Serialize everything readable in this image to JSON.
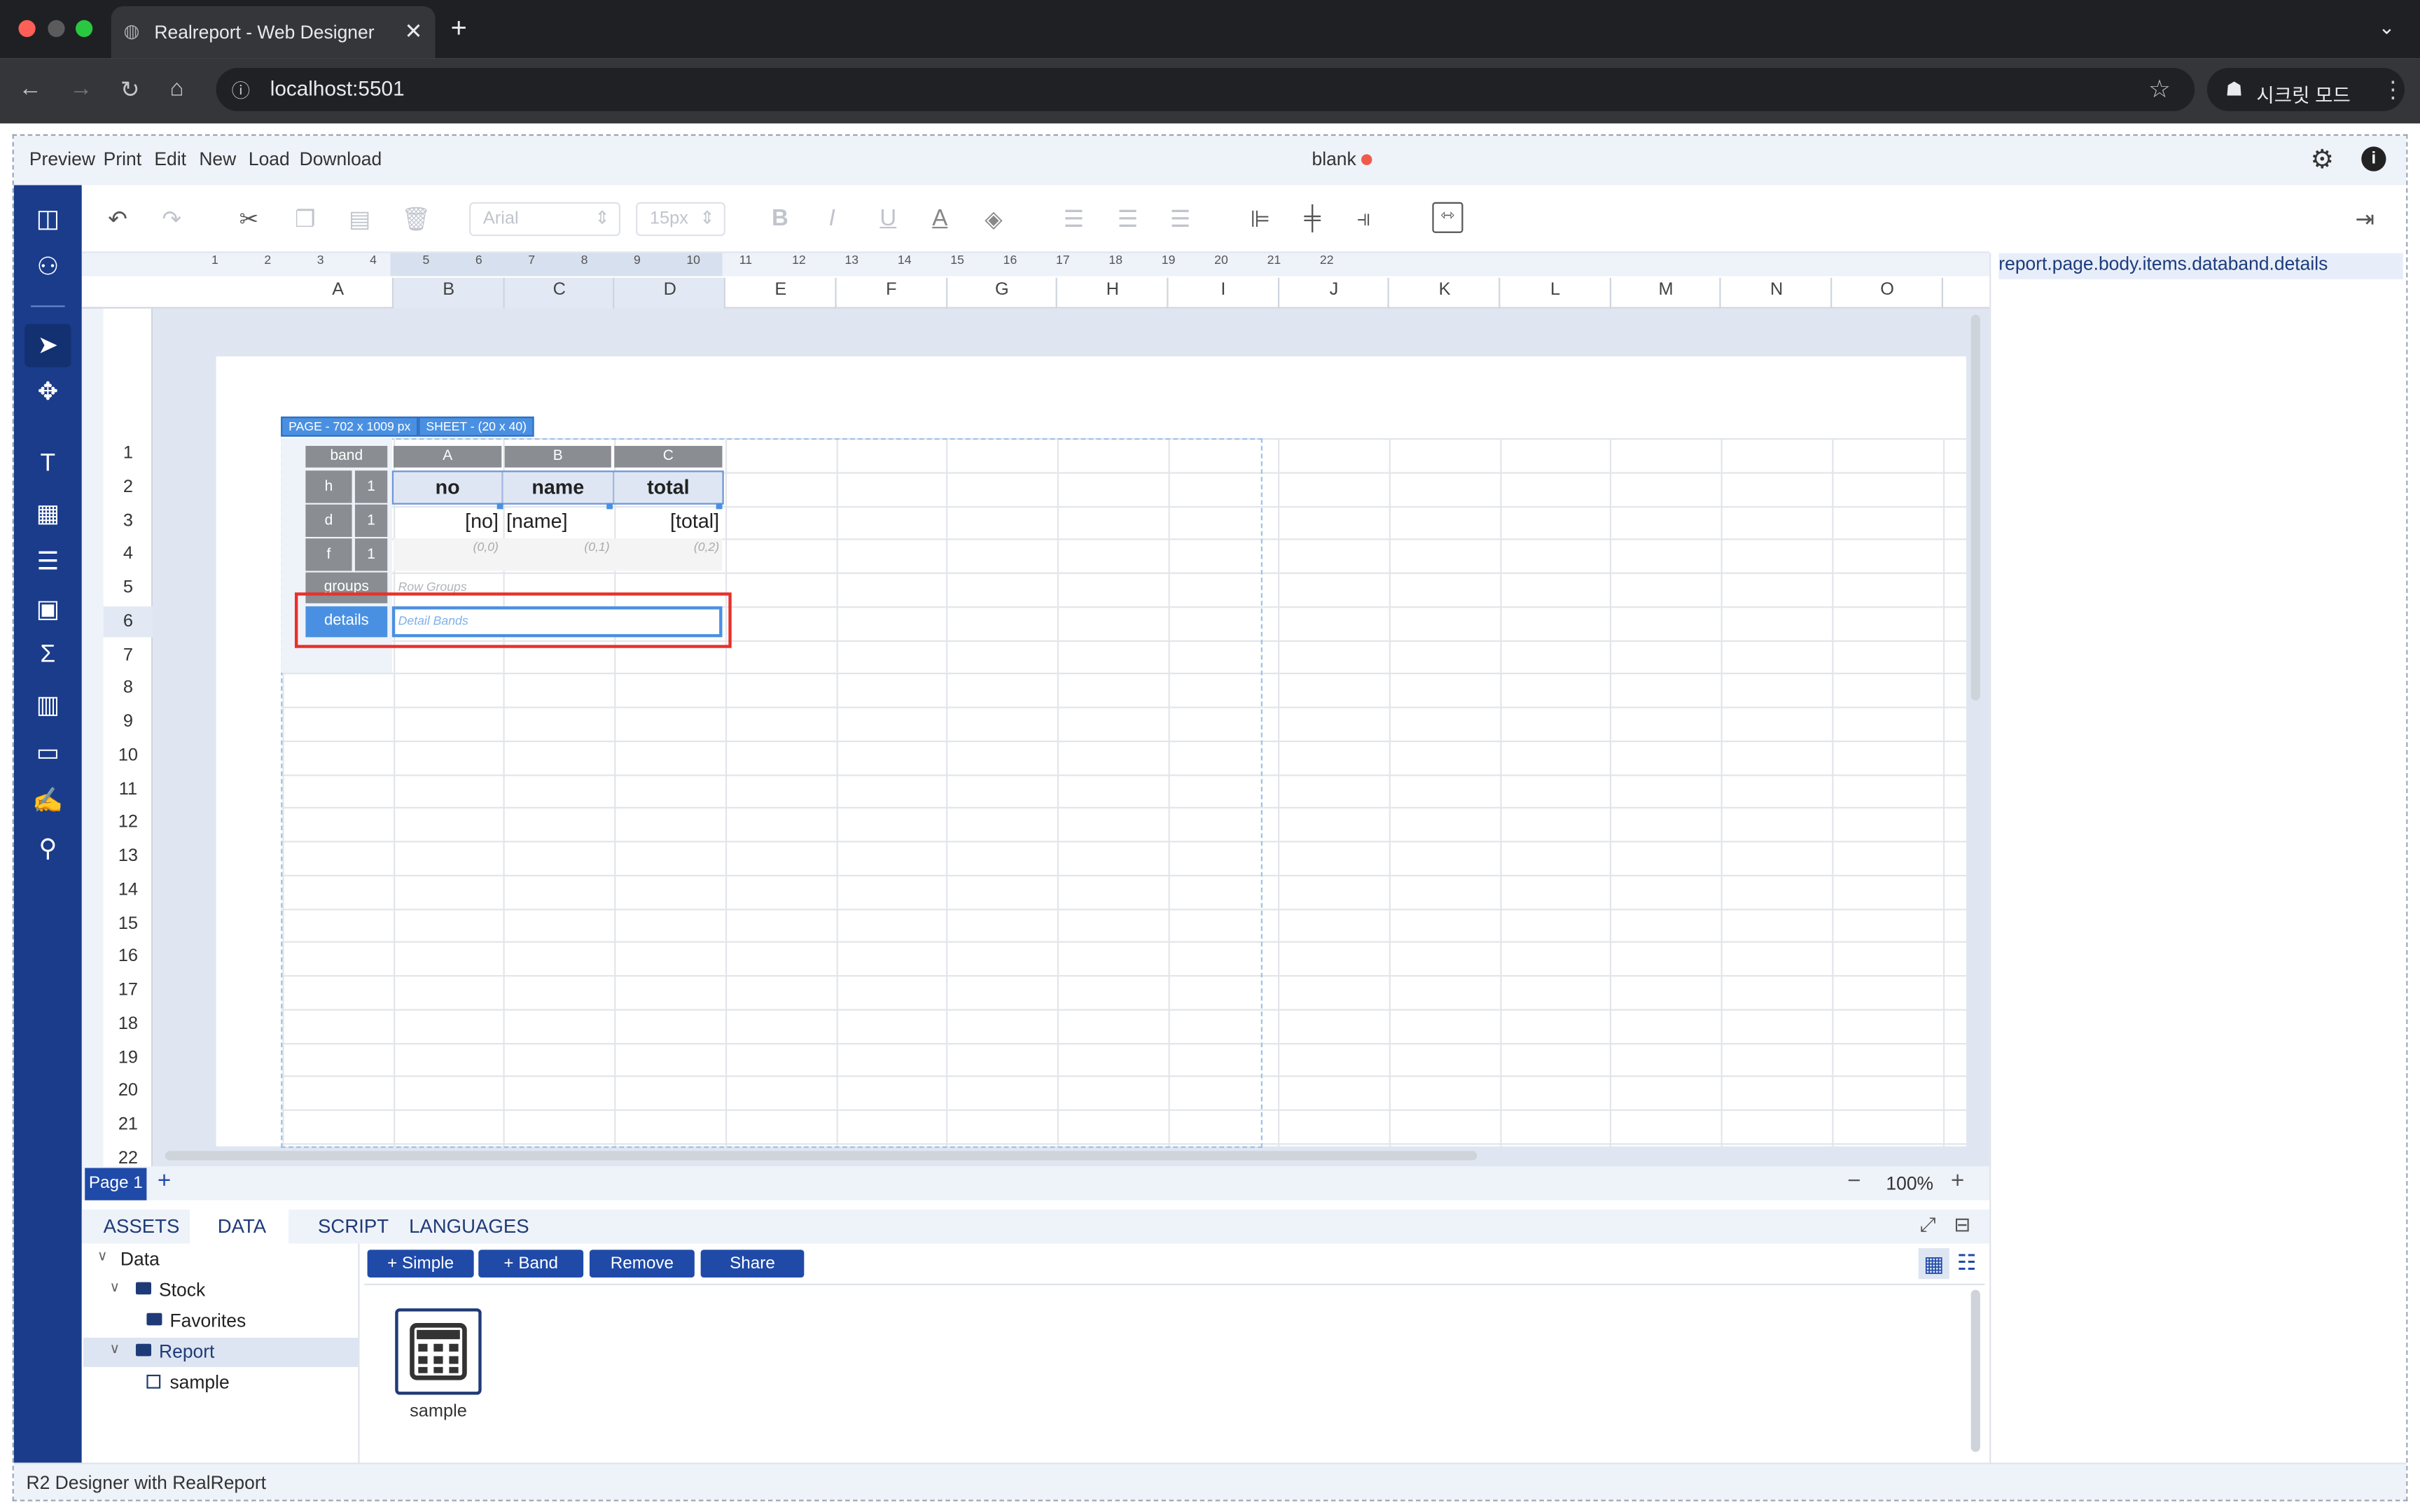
{
  "browser": {
    "tab_title": "Realreport - Web Designer",
    "url": "localhost:5501",
    "incognito_label": "시크릿 모드"
  },
  "menu": {
    "items": [
      "Preview",
      "Print",
      "Edit",
      "New",
      "Load",
      "Download"
    ],
    "doc_title": "blank"
  },
  "toolbar": {
    "font": "Arial",
    "size": "15px"
  },
  "panel": {
    "path": "report.page.body.items.databand.details"
  },
  "ruler": [
    "1",
    "2",
    "3",
    "4",
    "5",
    "6",
    "7",
    "8",
    "9",
    "10",
    "11",
    "12",
    "13",
    "14",
    "15",
    "16",
    "17",
    "18",
    "19",
    "20",
    "21",
    "22"
  ],
  "columns": [
    "A",
    "B",
    "C",
    "D",
    "E",
    "F",
    "G",
    "H",
    "I",
    "J",
    "K",
    "L",
    "M",
    "N",
    "O"
  ],
  "rows": [
    "1",
    "2",
    "3",
    "4",
    "5",
    "6",
    "7",
    "8",
    "9",
    "10",
    "11",
    "12",
    "13",
    "14",
    "15",
    "16",
    "17",
    "18",
    "19",
    "20",
    "21",
    "22"
  ],
  "badges": {
    "page": "PAGE - 702 x 1009 px",
    "sheet": "SHEET - (20 x 40)"
  },
  "band": {
    "band_label": "band",
    "cols": [
      "A",
      "B",
      "C"
    ],
    "h": "h",
    "h_n": "1",
    "d": "d",
    "d_n": "1",
    "f": "f",
    "f_n": "1",
    "header": [
      "no",
      "name",
      "total"
    ],
    "detail": [
      "[no]",
      "[name]",
      "[total]"
    ],
    "footer": [
      "(0,0)",
      "(0,1)",
      "(0,2)"
    ],
    "groups": "groups",
    "groups_hint": "Row Groups",
    "details": "details",
    "details_hint": "Detail Bands"
  },
  "pages": {
    "tab": "Page 1",
    "zoom": "100%"
  },
  "bottom": {
    "tabs": [
      "ASSETS",
      "DATA",
      "SCRIPT",
      "LANGUAGES"
    ],
    "buttons": [
      "+ Simple",
      "+ Band",
      "Remove",
      "Share"
    ],
    "tree": [
      "Data",
      "Stock",
      "Favorites",
      "Report",
      "sample"
    ],
    "tile": "sample"
  },
  "status": "R2 Designer with RealReport"
}
